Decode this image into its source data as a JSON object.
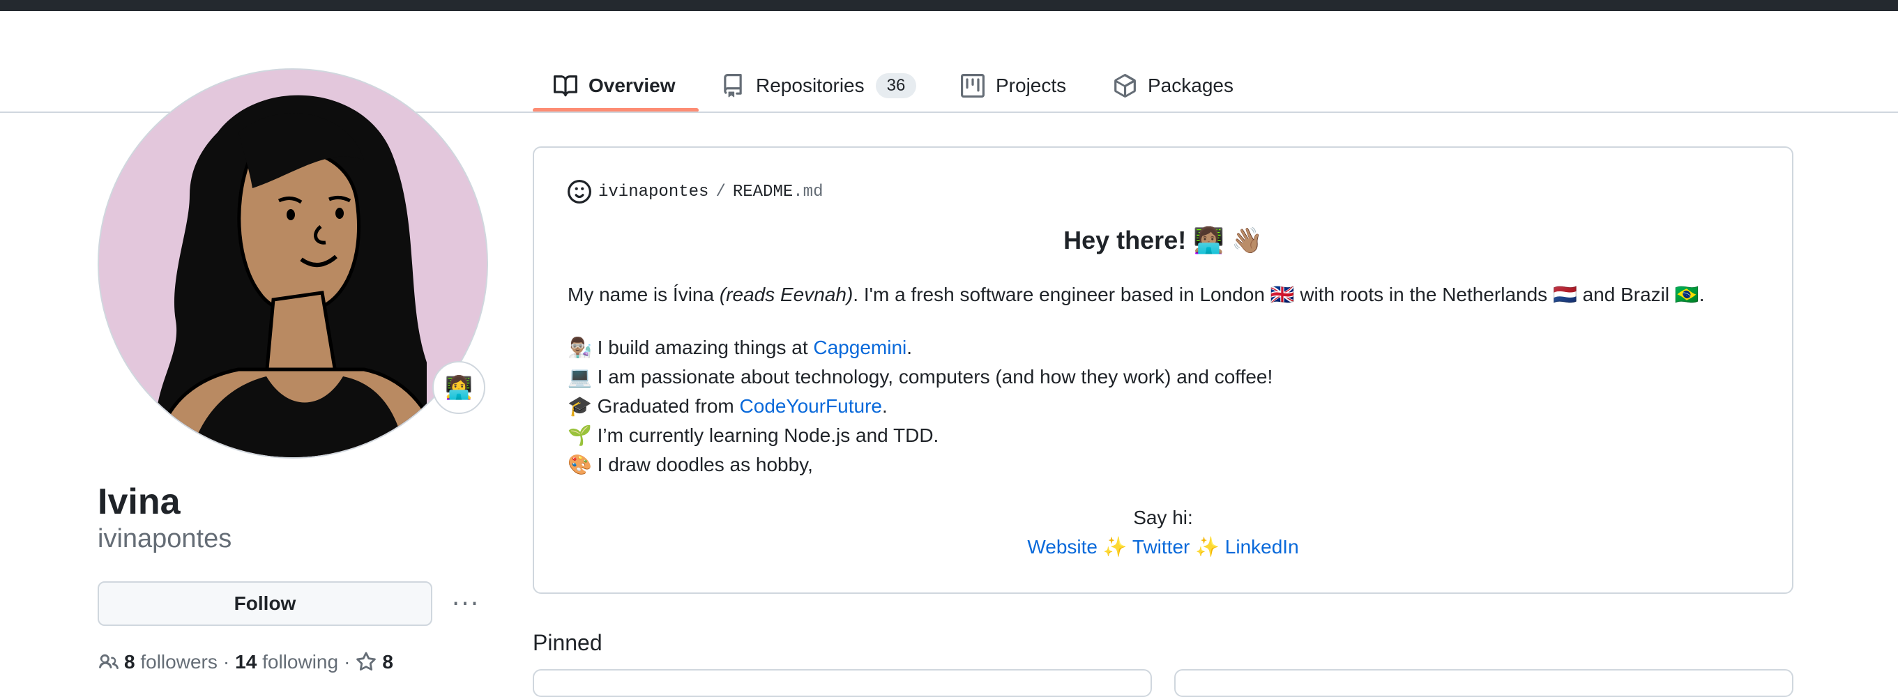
{
  "tabs": [
    {
      "label": "Overview",
      "icon": "book-icon"
    },
    {
      "label": "Repositories",
      "count": "36",
      "icon": "repo-icon"
    },
    {
      "label": "Projects",
      "icon": "project-icon"
    },
    {
      "label": "Packages",
      "icon": "package-icon"
    }
  ],
  "profile": {
    "status_emoji": "👩‍💻",
    "name": "Ivina",
    "login": "ivinapontes",
    "follow_label": "Follow",
    "more_label": "···",
    "followers_count": "8",
    "followers_label": "followers",
    "following_count": "14",
    "following_label": "following",
    "stars_count": "8",
    "separator": "·"
  },
  "readme": {
    "owner": "ivinapontes",
    "slash": "/",
    "file": "README",
    "ext": ".md",
    "heading": "Hey there! 👩🏽‍💻 👋🏽",
    "intro_a": "My name is Ívina ",
    "intro_em": "(reads Eevnah)",
    "intro_b": ". I'm a fresh software engineer based in London 🇬🇧 with roots in the Netherlands 🇳🇱 and Brazil 🇧🇷.",
    "line1_a": "👨🏽‍🔬 I build amazing things at ",
    "line1_link": "Capgemini",
    "line1_b": ".",
    "line2": "💻 I am passionate about technology, computers (and how they work) and coffee!",
    "line3_a": "🎓 Graduated from ",
    "line3_link": "CodeYourFuture",
    "line3_b": ".",
    "line4": "🌱 I’m currently learning Node.js and TDD.",
    "line5": "🎨 I draw doodles as hobby,",
    "say_hi": "Say hi:",
    "link_website": "Website",
    "link_twitter": "Twitter",
    "link_linkedin": "LinkedIn",
    "sparkle": " ✨ "
  },
  "pinned": {
    "title": "Pinned"
  },
  "colors": {
    "accent_underline": "#fd8c73",
    "link": "#0969da",
    "avatar_bg": "#e3c7dc"
  }
}
